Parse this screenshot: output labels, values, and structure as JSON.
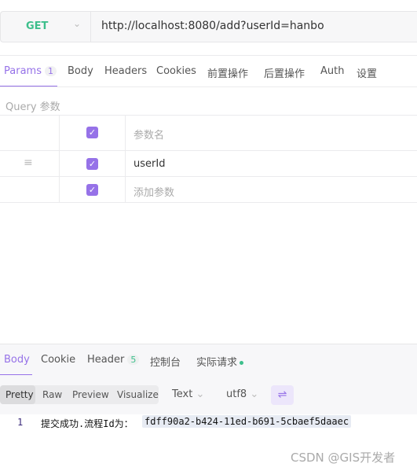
{
  "request": {
    "method": "GET",
    "url": "http://localhost:8080/add?userId=hanbo"
  },
  "tabs": [
    {
      "label": "Params",
      "badge": "1"
    },
    {
      "label": "Body"
    },
    {
      "label": "Headers"
    },
    {
      "label": "Cookies"
    },
    {
      "label": "前置操作"
    },
    {
      "label": "后置操作"
    },
    {
      "label": "Auth"
    },
    {
      "label": "设置"
    }
  ],
  "params": {
    "section_label": "Query 参数",
    "header_placeholder": "参数名",
    "rows": [
      {
        "name": "userId",
        "checked": true
      }
    ],
    "add_placeholder": "添加参数"
  },
  "response": {
    "tabs": [
      {
        "label": "Body"
      },
      {
        "label": "Cookie"
      },
      {
        "label": "Header",
        "badge": "5"
      },
      {
        "label": "控制台"
      },
      {
        "label": "实际请求"
      }
    ],
    "views": [
      "Pretty",
      "Raw",
      "Preview",
      "Visualize"
    ],
    "format": "Text",
    "encoding": "utf8",
    "lines": [
      {
        "num": "1",
        "prefix": "提交成功.流程Id为：",
        "highlight": "fdff90a2-b424-11ed-b691-5cbaef5daaec"
      }
    ]
  },
  "watermark": "CSDN @GIS开发者",
  "colors": {
    "accent": "#9672e8",
    "method": "#3dbf8c"
  }
}
